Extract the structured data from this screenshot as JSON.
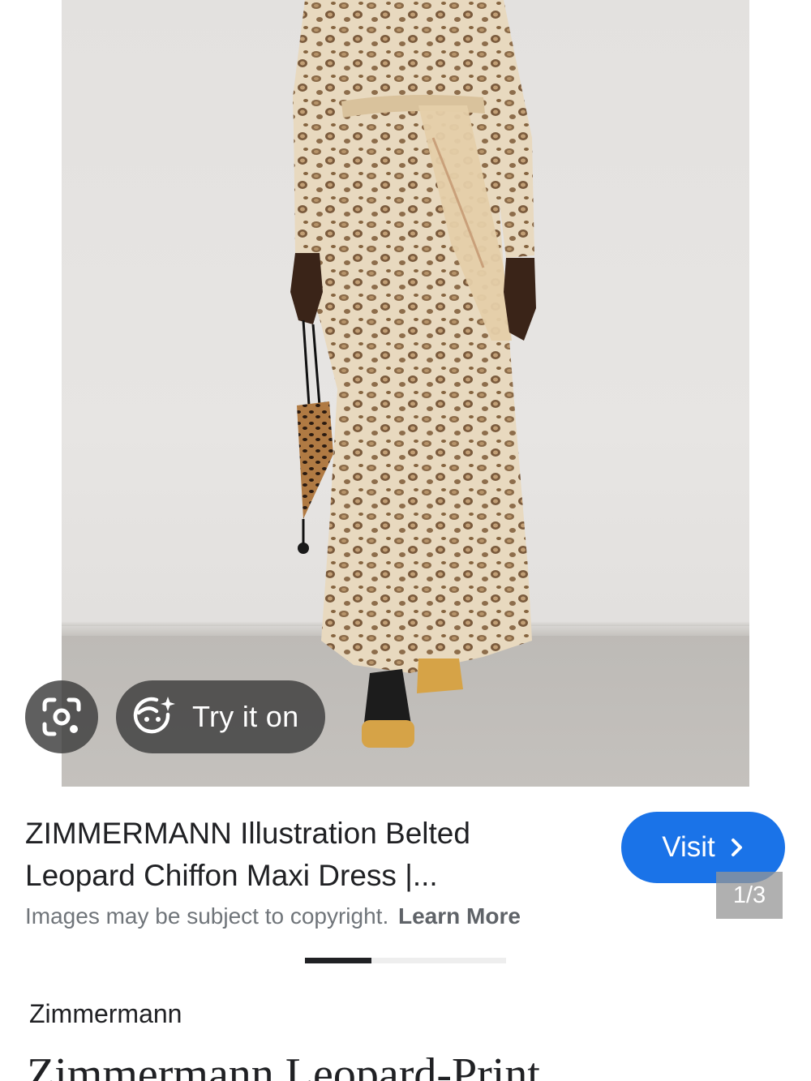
{
  "viewer": {
    "image_description": "",
    "lens_icon": "google-lens-icon",
    "try_on": {
      "icon": "face-sparkle-icon",
      "label": "Try it on"
    }
  },
  "result": {
    "title_line1": "ZIMMERMANN Illustration Belted",
    "title_line2": "Leopard Chiffon Maxi Dress |...",
    "visit_label": "Visit",
    "visit_icon": "chevron-right-icon",
    "counter": "1/3",
    "copyright_text": "Images may be subject to copyright.",
    "learn_more": "Learn More",
    "carousel_progress": 0.33
  },
  "page": {
    "source": "Zimmermann",
    "heading": "Zimmermann Leopard-Print"
  },
  "colors": {
    "visit_button": "#1a73e8",
    "overlay_button": "#3c3c3c",
    "title_text": "#202124",
    "secondary_text": "#70757a"
  }
}
